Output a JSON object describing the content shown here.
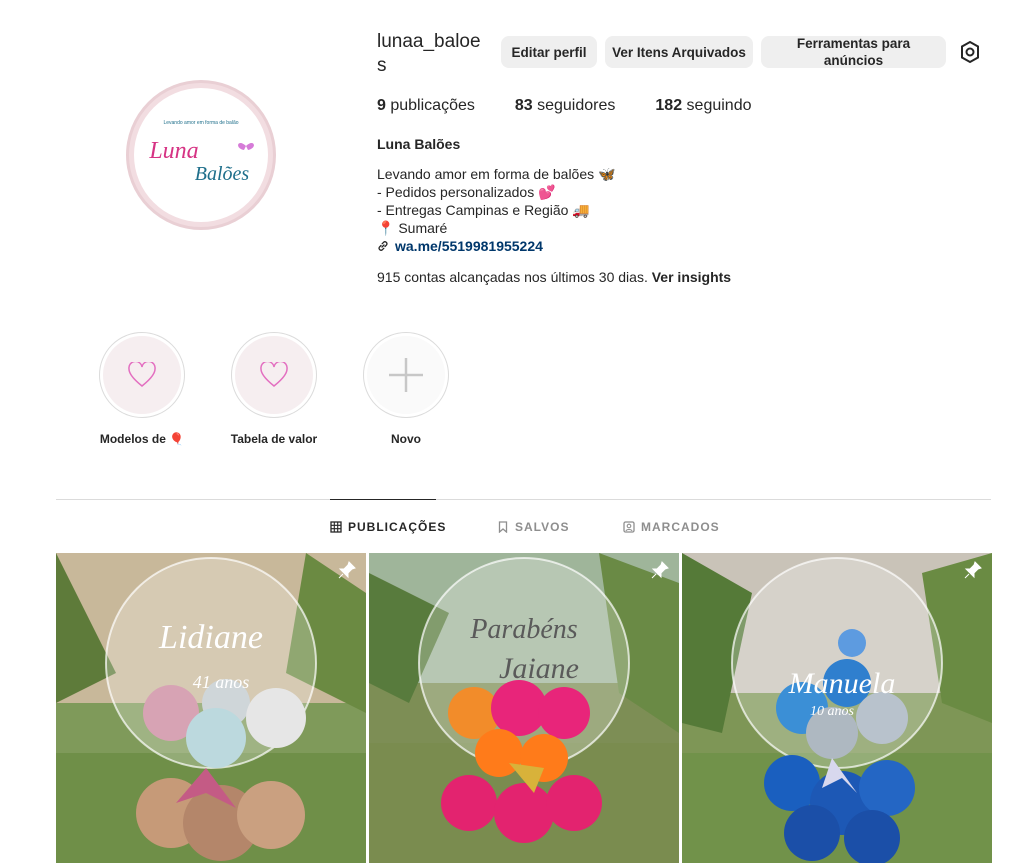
{
  "profile": {
    "username": "lunaa_baloes",
    "display_name": "Luna Balões",
    "avatar_logo": {
      "line1": "Levando amor em forma de balão",
      "brand1": "Luna",
      "brand2": "Balões"
    }
  },
  "buttons": {
    "edit_profile": "Editar perfil",
    "archive": "Ver Itens Arquivados",
    "ad_tools": "Ferramentas para anúncios"
  },
  "stats": {
    "posts_count": "9",
    "posts_label": "publicações",
    "followers_count": "83",
    "followers_label": "seguidores",
    "following_count": "182",
    "following_label": "seguindo"
  },
  "bio": {
    "line1": "Levando amor em forma de balões 🦋",
    "line2": "- Pedidos personalizados 💕",
    "line3": "- Entregas Campinas e Região 🚚",
    "line4": "📍 Sumaré",
    "link": "wa.me/5519981955224"
  },
  "insights": {
    "text": "915 contas alcançadas nos últimos 30 dias.",
    "link": "Ver insights"
  },
  "highlights": [
    {
      "label": "Modelos de 🎈",
      "icon": "heart-icon"
    },
    {
      "label": "Tabela de valor",
      "icon": "heart-icon"
    },
    {
      "label": "Novo",
      "icon": "plus-icon"
    }
  ],
  "tabs": {
    "posts": "PUBLICAÇÕES",
    "saved": "SALVOS",
    "tagged": "MARCADOS"
  },
  "posts": [
    {
      "balloon_text": "Lidiane",
      "sub_text": "41 anos",
      "pinned": true
    },
    {
      "balloon_text": "Parabéns",
      "sub_text": "Jaiane",
      "pinned": true
    },
    {
      "balloon_text": "Manuela",
      "sub_text": "10 anos",
      "pinned": true
    }
  ],
  "colors": {
    "link_blue": "#00376b",
    "button_bg": "#efefef",
    "divider": "#dbdbdb",
    "brand_pink": "#d63384",
    "brand_teal": "#1f6f8b"
  }
}
